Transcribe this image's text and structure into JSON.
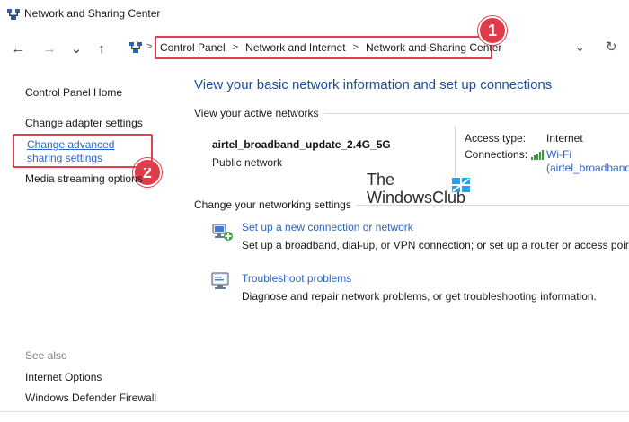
{
  "window": {
    "title": "Network and Sharing Center"
  },
  "address_bar": {
    "breadcrumbs": [
      "Control Panel",
      "Network and Internet",
      "Network and Sharing Center"
    ],
    "sep": ">"
  },
  "nav": {
    "back": "←",
    "forward": "→",
    "recent": "⌄",
    "up": "↑",
    "dropdown": "⌄",
    "refresh": "↻"
  },
  "callouts": [
    "1",
    "2"
  ],
  "sidebar": {
    "items": [
      "Control Panel Home",
      "Change adapter settings",
      "Change advanced sharing settings",
      "Media streaming options"
    ],
    "see_also_label": "See also",
    "see_also": [
      "Internet Options",
      "Windows Defender Firewall"
    ]
  },
  "main": {
    "heading": "View your basic network information and set up connections",
    "active_label": "View your active networks",
    "network": {
      "name": "airtel_broadband_update_2.4G_5G",
      "type": "Public network",
      "access_type_label": "Access type:",
      "access_type_value": "Internet",
      "connections_label": "Connections:",
      "connection_line1": "Wi-Fi",
      "connection_line2": "(airtel_broadband"
    },
    "change_label": "Change your networking settings",
    "tasks": [
      {
        "title": "Set up a new connection or network",
        "desc": "Set up a broadband, dial-up, or VPN connection; or set up a router or access point."
      },
      {
        "title": "Troubleshoot problems",
        "desc": "Diagnose and repair network problems, or get troubleshooting information."
      }
    ]
  },
  "watermark": {
    "line1": "The",
    "line2": "WindowsClub"
  },
  "colors": {
    "accent_red": "#e0404f",
    "link": "#2d63c6",
    "heading": "#1e4e9c"
  }
}
